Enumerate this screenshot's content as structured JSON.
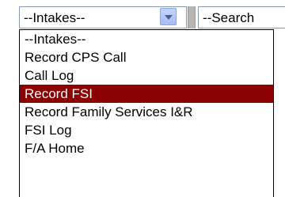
{
  "intakes_select": {
    "value": "--Intakes--",
    "button_icon": "chevron-down-icon"
  },
  "search_select": {
    "value": "--Search"
  },
  "dropdown": {
    "options": [
      "--Intakes--",
      "Record CPS Call",
      "Call Log",
      "Record FSI",
      "Record Family Services I&R",
      "FSI Log",
      "F/A Home"
    ],
    "selected_index": 3
  },
  "colors": {
    "selected_bg": "#8b0000",
    "selected_fg": "#ffffff",
    "border": "#7f9db9"
  }
}
